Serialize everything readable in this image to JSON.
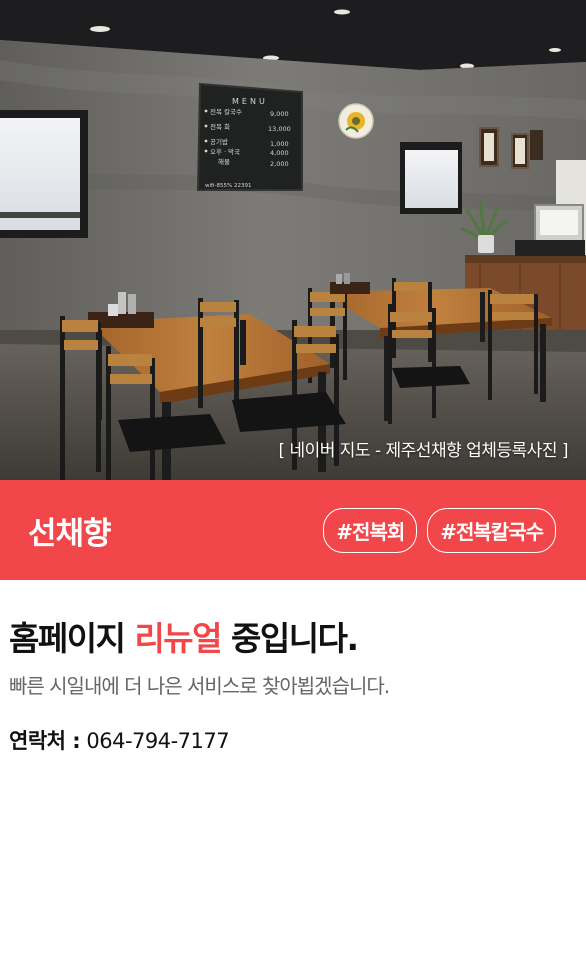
{
  "hero": {
    "caption": "[ 네이버 지도 - 제주선채향 업체등록사진 ]",
    "menu_board": {
      "title": "MENU",
      "items": [
        {
          "name": "전복 칼국수",
          "price": "9,000"
        },
        {
          "name": "전복 회",
          "price": "13,000"
        },
        {
          "name": "공기밥",
          "price": "1,000"
        },
        {
          "name": "오후 · 막국",
          "price": "4,000"
        },
        {
          "name": "해물",
          "price": "2,000"
        }
      ],
      "wifi": "wifi-855% 22391"
    }
  },
  "brand": {
    "name": "선채향",
    "tags": [
      "#전복회",
      "#전복칼국수"
    ]
  },
  "notice": {
    "headline_prefix": "홈페이지 ",
    "headline_accent": "리뉴얼",
    "headline_suffix": " 중입니다.",
    "subtext": "빠른 시일내에 더 나은 서비스로 찾아뵙겠습니다.",
    "contact_label": "연락처 :",
    "contact_phone": "064-794-7177"
  },
  "colors": {
    "accent": "#f2474a",
    "subtext": "#666666"
  }
}
